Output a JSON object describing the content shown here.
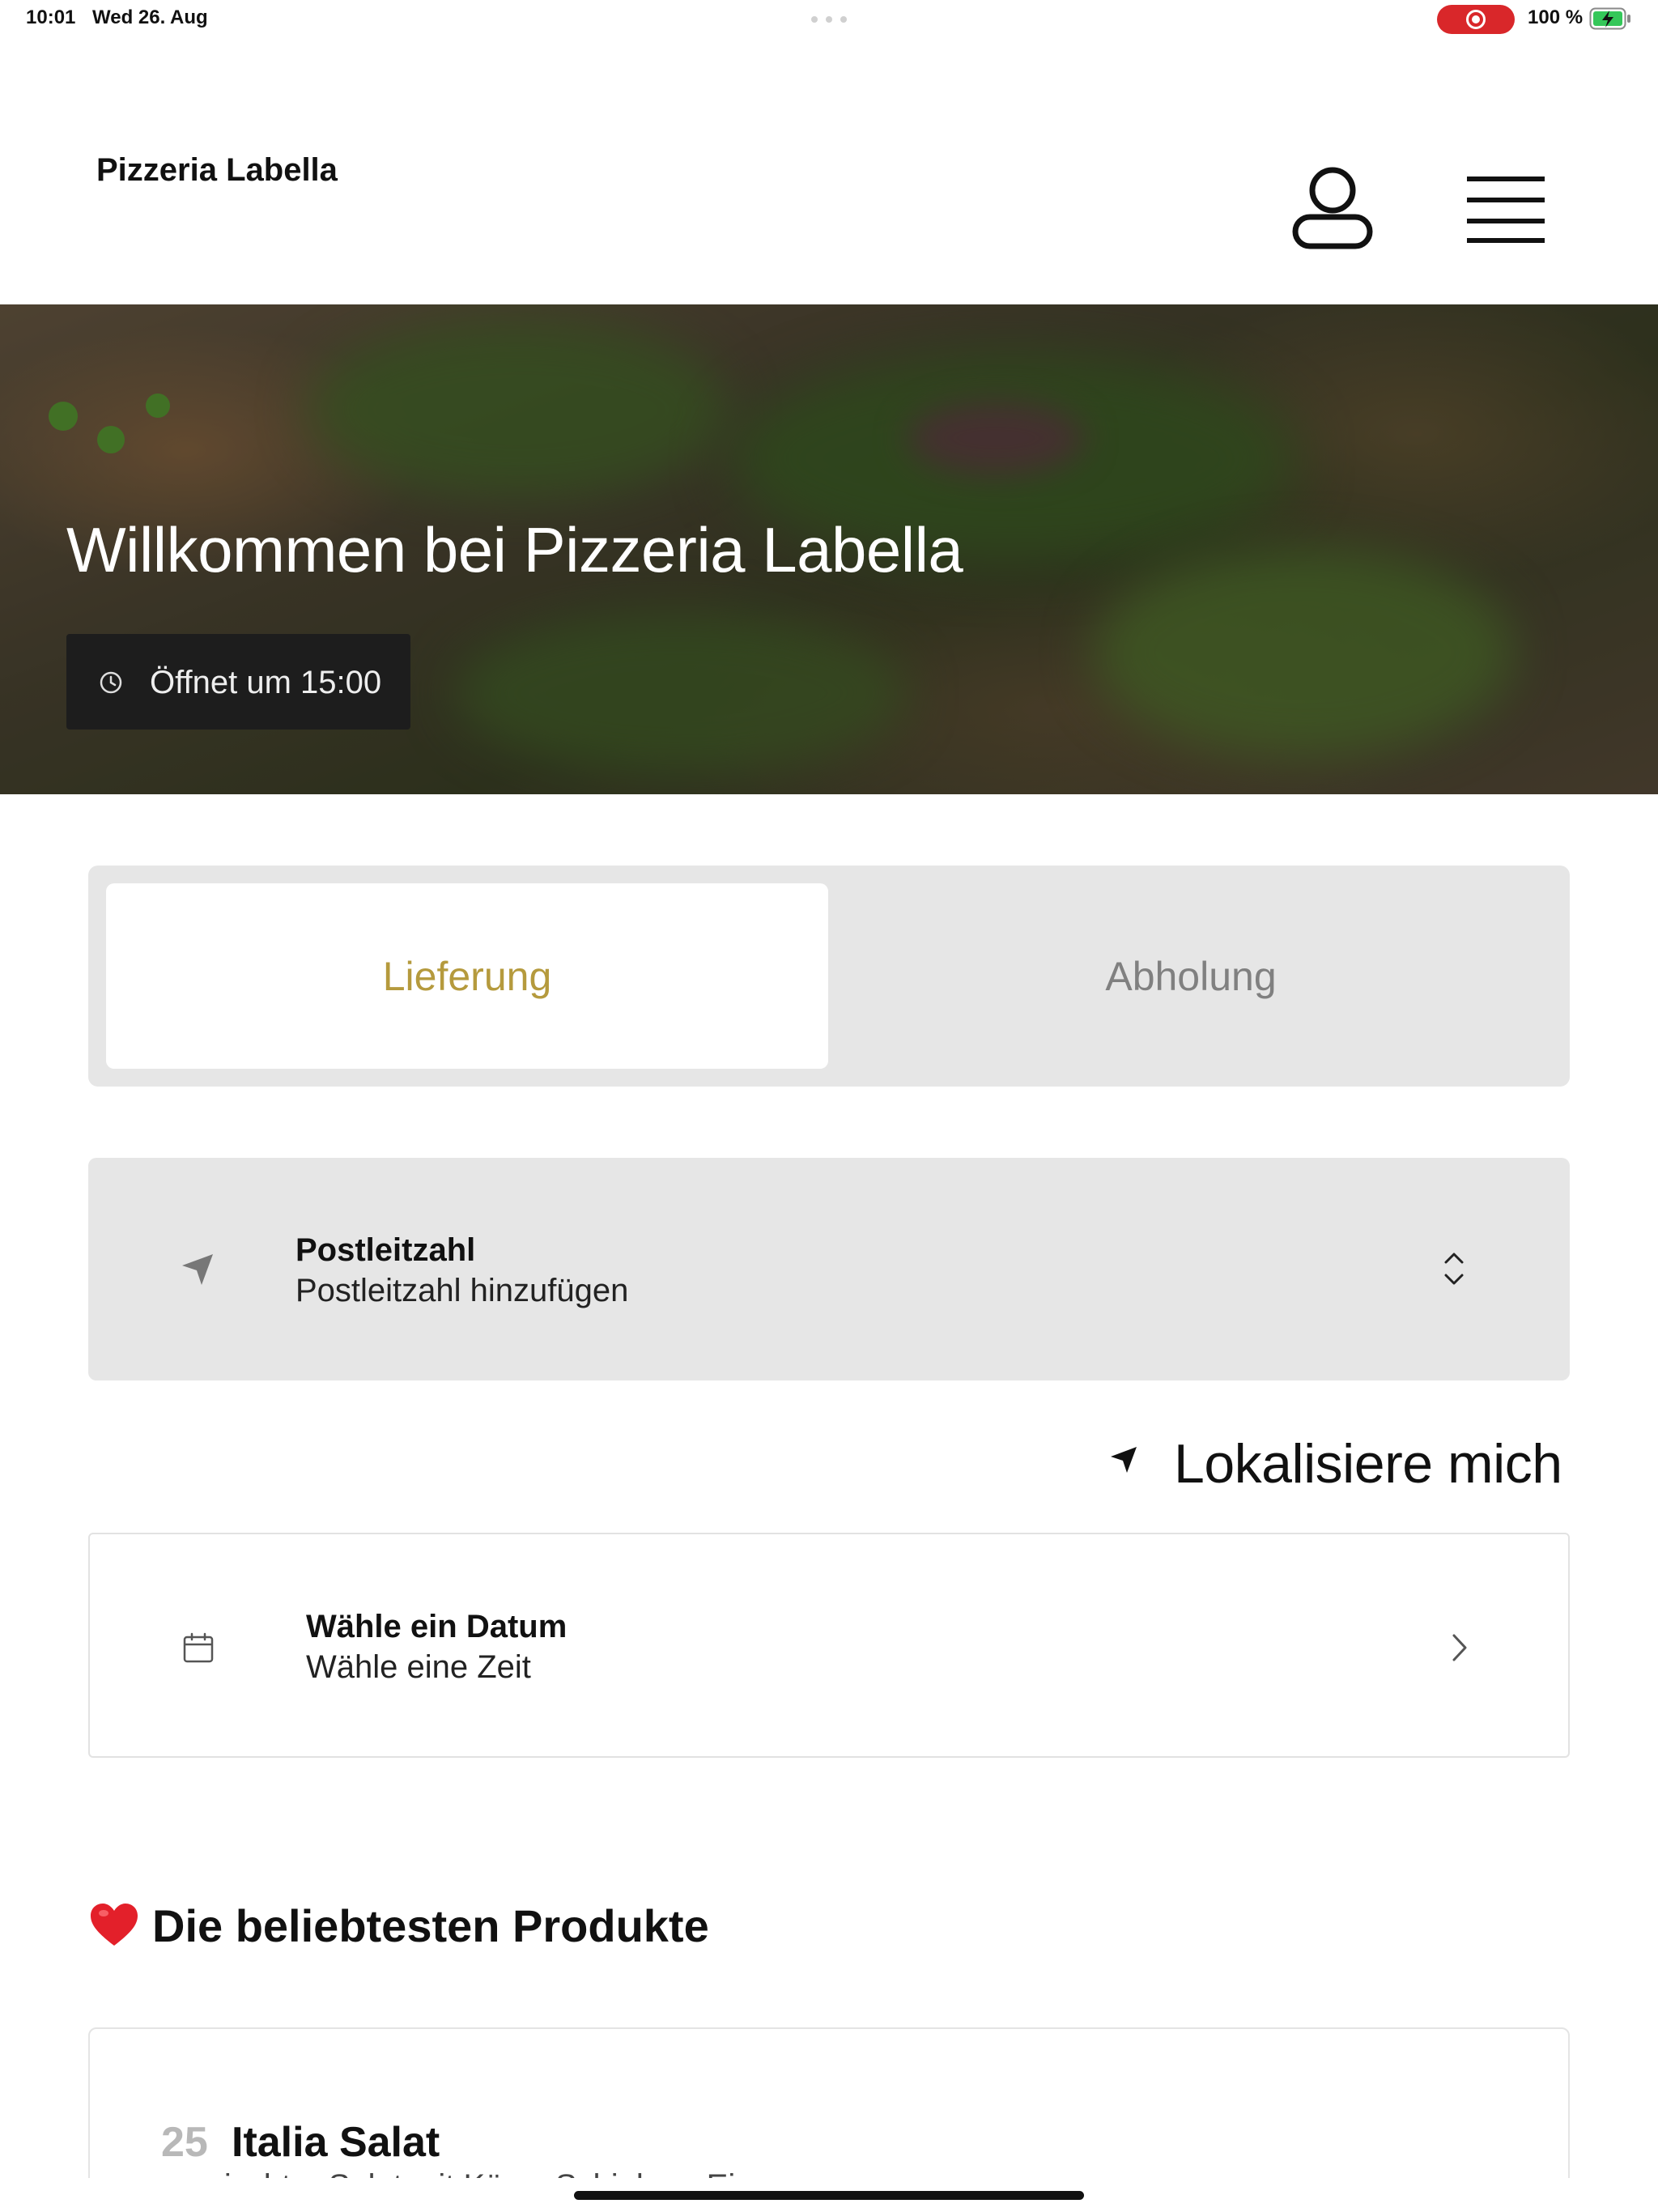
{
  "status_bar": {
    "time": "10:01",
    "date": "Wed 26. Aug",
    "battery_percent": "100 %",
    "battery_level": 1.0,
    "recording_indicator_color": "#d9272a",
    "battery_color": "#34c759"
  },
  "header": {
    "brand": "Pizzeria Labella",
    "account_icon": "user-outline-icon",
    "menu_icon": "hamburger-menu-icon"
  },
  "hero": {
    "title": "Willkommen bei Pizzeria Labella",
    "hours_icon": "clock-icon",
    "hours_text": "Öffnet um 15:00"
  },
  "order_mode": {
    "tabs": [
      {
        "label": "Lieferung",
        "selected": true
      },
      {
        "label": "Abholung",
        "selected": false
      }
    ],
    "accent_color": "#b59a3d"
  },
  "postal_code": {
    "icon": "location-arrow-icon",
    "label": "Postleitzahl",
    "placeholder": "Postleitzahl hinzufügen",
    "trailing_icon": "chevron-up-down-icon"
  },
  "locate": {
    "icon": "location-arrow-icon",
    "label": "Lokalisiere mich"
  },
  "schedule": {
    "icon": "calendar-icon",
    "date_label": "Wähle ein Datum",
    "time_label": "Wähle eine Zeit",
    "trailing_icon": "chevron-right-icon"
  },
  "popular": {
    "icon": "red-heart-icon",
    "heading": "Die beliebtesten Produkte",
    "products": [
      {
        "number": "25",
        "name": "Italia Salat",
        "description": "gemischter Salat mit Käse, Schinken, Ei"
      }
    ]
  }
}
